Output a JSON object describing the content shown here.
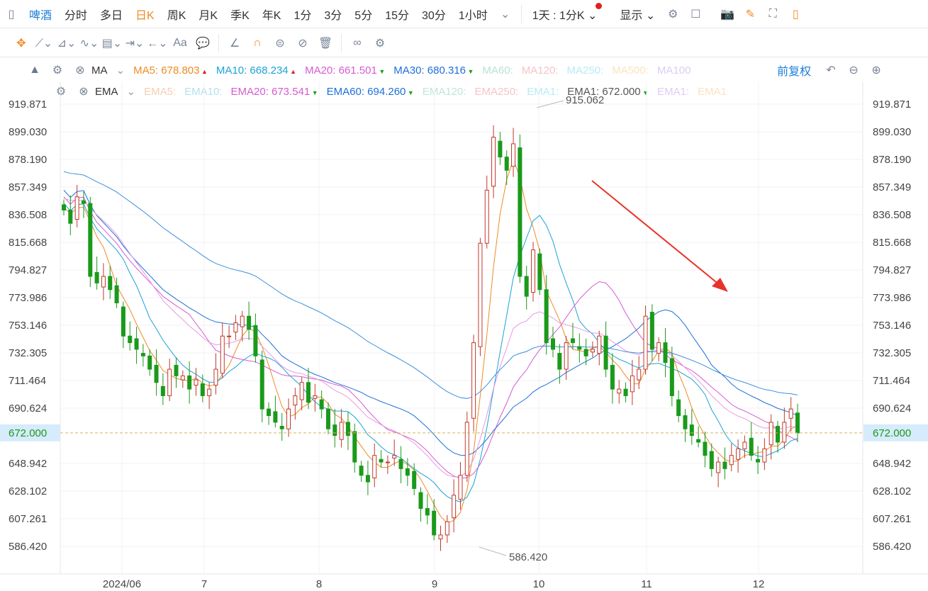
{
  "toolbar": {
    "stock_name": "啤酒",
    "periods": [
      "分时",
      "多日",
      "日K",
      "周K",
      "月K",
      "季K",
      "年K",
      "1分",
      "3分",
      "5分",
      "15分",
      "30分",
      "1小时"
    ],
    "active_period": "日K",
    "multi_label": "1天 : 1分K",
    "display_label": "显示"
  },
  "drawing_tools": [
    "move",
    "line",
    "polyline",
    "wave",
    "fib",
    "measure",
    "arrow",
    "text",
    "comment",
    "angle",
    "magnet",
    "lock",
    "hide",
    "delete",
    "compare",
    "settings"
  ],
  "ma_row": {
    "name": "MA",
    "items": [
      {
        "label": "MA5: 678.803",
        "color": "#f08a24",
        "trend": "up"
      },
      {
        "label": "MA10: 668.234",
        "color": "#1aa3d9",
        "trend": "up"
      },
      {
        "label": "MA20: 661.501",
        "color": "#d65bd0",
        "trend": "down"
      },
      {
        "label": "MA30: 680.316",
        "color": "#1e6fd9",
        "trend": "down"
      },
      {
        "label": "MA60:",
        "color": "#b9e3cf",
        "trend": ""
      },
      {
        "label": "MA120:",
        "color": "#f5c4c8",
        "trend": ""
      },
      {
        "label": "MA250:",
        "color": "#b5ecf5",
        "trend": ""
      },
      {
        "label": "MA500:",
        "color": "#fbe3c0",
        "trend": ""
      },
      {
        "label": "MA100",
        "color": "#dccdf5",
        "trend": ""
      }
    ],
    "adjust": "前复权"
  },
  "ema_row": {
    "name": "EMA",
    "items": [
      {
        "label": "EMA5:",
        "color": "#f6cdb4",
        "trend": ""
      },
      {
        "label": "EMA10:",
        "color": "#b5e0ee",
        "trend": ""
      },
      {
        "label": "EMA20: 673.541",
        "color": "#d65bd0",
        "trend": "down"
      },
      {
        "label": "EMA60: 694.260",
        "color": "#1e6fd9",
        "trend": "down"
      },
      {
        "label": "EMA120:",
        "color": "#bfe6d8",
        "trend": ""
      },
      {
        "label": "EMA250:",
        "color": "#f5c4c8",
        "trend": ""
      },
      {
        "label": "EMA1:",
        "color": "#b5ecf5",
        "trend": ""
      },
      {
        "label": "EMA1: 672.000",
        "color": "#555555",
        "trend": "down"
      },
      {
        "label": "EMA1:",
        "color": "#dccdf5",
        "trend": ""
      },
      {
        "label": "EMA1",
        "color": "#fbe3c0",
        "trend": ""
      }
    ]
  },
  "chart_data": {
    "type": "candlestick",
    "y_ticks": [
      919.871,
      899.03,
      878.19,
      857.349,
      836.508,
      815.668,
      794.827,
      773.986,
      753.146,
      732.305,
      711.464,
      690.624,
      648.942,
      628.102,
      607.261,
      586.42
    ],
    "ylim": [
      586.42,
      919.871
    ],
    "x_ticks": [
      "2024/06",
      "7",
      "8",
      "9",
      "10",
      "11",
      "12"
    ],
    "current_price": "672.000",
    "max_label": "915.062",
    "min_label": "586.420",
    "closes": [
      840,
      830,
      850,
      845,
      790,
      785,
      790,
      780,
      770,
      745,
      740,
      735,
      730,
      720,
      710,
      700,
      720,
      715,
      715,
      705,
      712,
      700,
      705,
      720,
      745,
      745,
      755,
      760,
      750,
      730,
      690,
      685,
      680,
      675,
      690,
      700,
      710,
      695,
      700,
      690,
      675,
      670,
      680,
      670,
      650,
      640,
      635,
      655,
      650,
      650,
      655,
      645,
      640,
      630,
      615,
      610,
      595,
      595,
      605,
      625,
      640,
      680,
      740,
      815,
      855,
      895,
      880,
      870,
      890,
      790,
      775,
      810,
      780,
      740,
      735,
      720,
      740,
      740,
      735,
      730,
      735,
      745,
      720,
      705,
      705,
      700,
      715,
      720,
      760,
      735,
      740,
      725,
      700,
      685,
      675,
      670,
      665,
      655,
      645,
      650,
      645,
      655,
      660,
      665,
      655,
      650,
      660,
      680,
      665,
      680,
      690,
      672
    ]
  }
}
